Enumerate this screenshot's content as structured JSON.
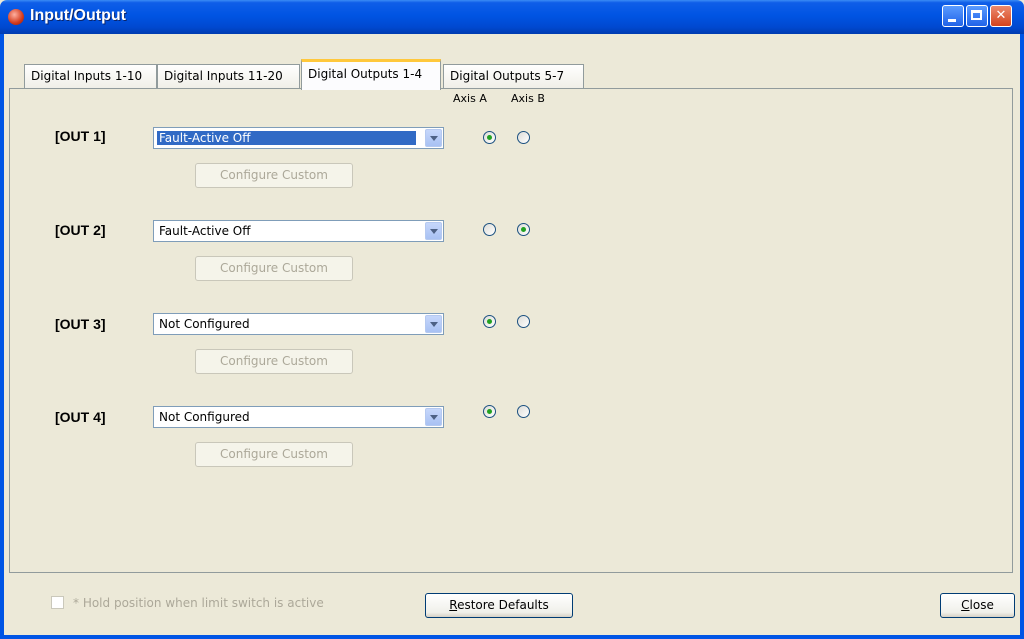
{
  "window": {
    "title": "Input/Output"
  },
  "tabs": [
    {
      "label": "Digital Inputs 1-10"
    },
    {
      "label": "Digital Inputs 11-20"
    },
    {
      "label": "Digital Outputs 1-4"
    },
    {
      "label": "Digital Outputs 5-7"
    }
  ],
  "active_tab": "Digital Outputs 1-4",
  "axis_headers": {
    "a": "Axis A",
    "b": "Axis B"
  },
  "outputs": [
    {
      "label": "[OUT 1]",
      "selection": "Fault-Active Off",
      "configure_label": "Configure Custom",
      "axis": "A"
    },
    {
      "label": "[OUT 2]",
      "selection": "Fault-Active Off",
      "configure_label": "Configure Custom",
      "axis": "B"
    },
    {
      "label": "[OUT 3]",
      "selection": "Not Configured",
      "configure_label": "Configure Custom",
      "axis": "A"
    },
    {
      "label": "[OUT 4]",
      "selection": "Not Configured",
      "configure_label": "Configure Custom",
      "axis": "A"
    }
  ],
  "footer": {
    "hold_label": "* Hold position when limit switch is active",
    "hold_checked": false,
    "restore_mnemonic": "R",
    "restore_rest": "estore Defaults",
    "close_mnemonic": "C",
    "close_rest": "lose"
  },
  "colors": {
    "title_bar": "#0054e3",
    "window_bg": "#ece9d8",
    "selection": "#316ac5",
    "active_tab_highlight": "#ffc83c"
  }
}
